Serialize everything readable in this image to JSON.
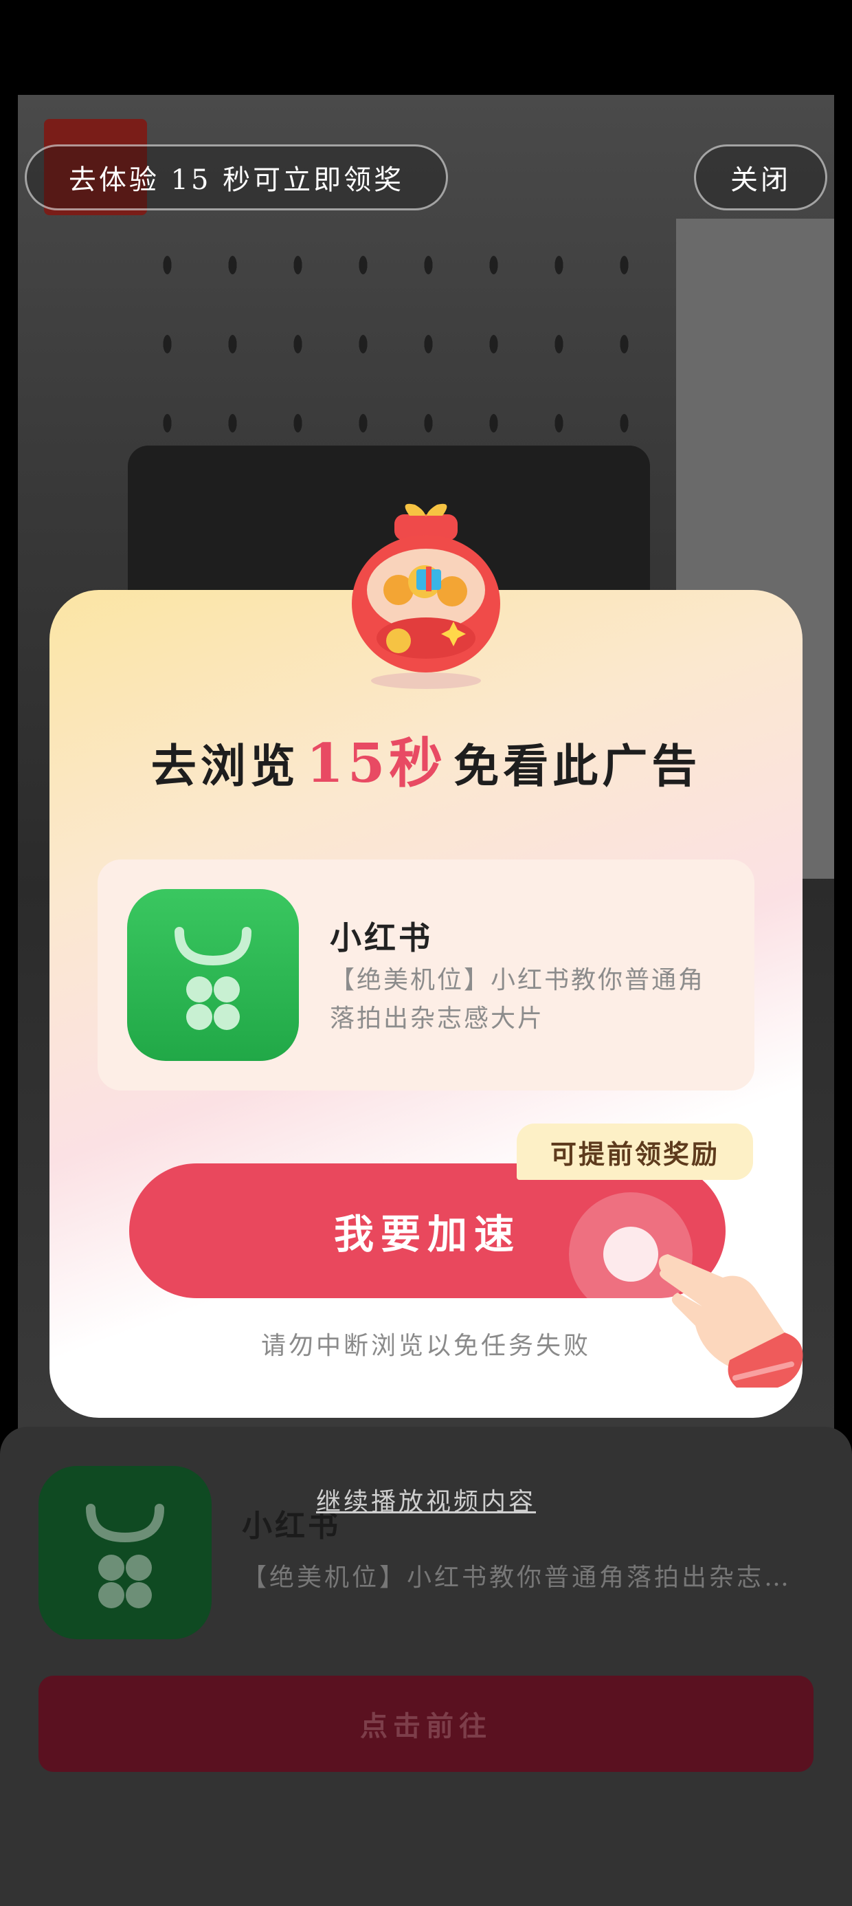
{
  "top_bar": {
    "experience_label": "去体验 15 秒可立即领奖",
    "close_label": "关闭"
  },
  "modal": {
    "headline_prefix": "去浏览",
    "headline_highlight": "15秒",
    "headline_suffix": "免看此广告",
    "app": {
      "name": "小红书",
      "description": "【绝美机位】小红书教你普通角落拍出杂志感大片"
    },
    "badge": "可提前领奖励",
    "speed_button": "我要加速",
    "warning": "请勿中断浏览以免任务失败"
  },
  "continue_link": "继续播放视频内容",
  "bottom_sheet": {
    "app_name": "小红书",
    "description": "【绝美机位】小红书教你普通角落拍出杂志感大片",
    "go_button": "点击前往"
  },
  "colors": {
    "accent_red": "#e9485d",
    "highlight_yellow": "#fde7a0",
    "app_green": "#2bb54f"
  }
}
